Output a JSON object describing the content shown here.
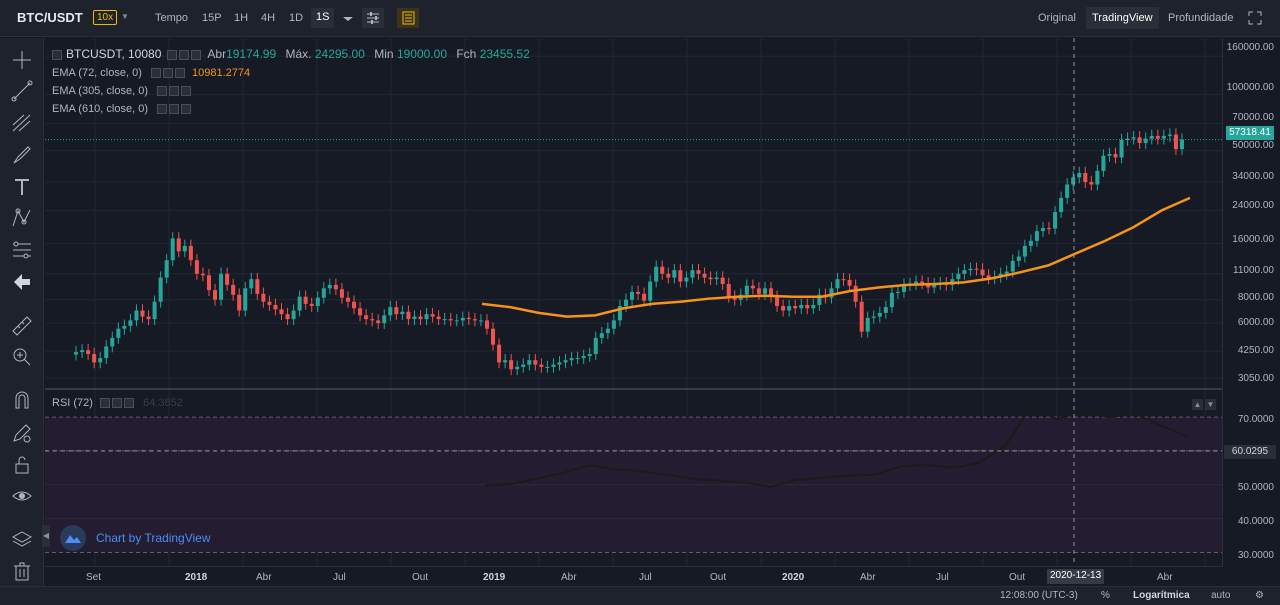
{
  "header": {
    "symbol": "BTC/USDT",
    "leverage": "10x",
    "timeframes": [
      {
        "label": "Tempo",
        "active": false
      },
      {
        "label": "15P",
        "active": false
      },
      {
        "label": "1H",
        "active": false
      },
      {
        "label": "4H",
        "active": false
      },
      {
        "label": "1D",
        "active": false
      },
      {
        "label": "1S",
        "active": true
      }
    ],
    "views": [
      {
        "label": "Original",
        "active": false
      },
      {
        "label": "TradingView",
        "active": true
      },
      {
        "label": "Profundidade",
        "active": false
      }
    ]
  },
  "legend": {
    "symbol": "BTCUSDT, 10080",
    "open_label": "Abr",
    "open": "19174.99",
    "high_label": "Máx.",
    "high": "24295.00",
    "low_label": "Min",
    "low": "19000.00",
    "close_label": "Fch",
    "close": "23455.52"
  },
  "indicators": [
    {
      "label": "EMA (72, close, 0)",
      "value": "10981.2774"
    },
    {
      "label": "EMA (305, close, 0)",
      "value": ""
    },
    {
      "label": "EMA (610, close, 0)",
      "value": ""
    }
  ],
  "rsi": {
    "label": "RSI (72)",
    "value": "64.3852",
    "levels": [
      "70.0000",
      "60.0295",
      "50.0000",
      "40.0000",
      "30.0000"
    ]
  },
  "price_axis": [
    "160000.00",
    "100000.00",
    "70000.00",
    "50000.00",
    "34000.00",
    "24000.00",
    "16000.00",
    "11000.00",
    "8000.00",
    "6000.00",
    "4250.00",
    "3050.00"
  ],
  "last_price": "57318.41",
  "time_axis": [
    {
      "label": "Set",
      "bold": false
    },
    {
      "label": "2018",
      "bold": true
    },
    {
      "label": "Abr",
      "bold": false
    },
    {
      "label": "Jul",
      "bold": false
    },
    {
      "label": "Out",
      "bold": false
    },
    {
      "label": "2019",
      "bold": true
    },
    {
      "label": "Abr",
      "bold": false
    },
    {
      "label": "Jul",
      "bold": false
    },
    {
      "label": "Out",
      "bold": false
    },
    {
      "label": "2020",
      "bold": true
    },
    {
      "label": "Abr",
      "bold": false
    },
    {
      "label": "Jul",
      "bold": false
    },
    {
      "label": "Out",
      "bold": false
    },
    {
      "label": "Abr",
      "bold": false
    }
  ],
  "crosshair_date": "2020-12-13",
  "watermark": "Chart by TradingView",
  "footer": {
    "time": "12:08:00 (UTC-3)",
    "percent": "%",
    "log": "Logarítmica",
    "auto": "auto"
  },
  "colors": {
    "up": "#26a69a",
    "down": "#ef5350",
    "ema": "#f7931a",
    "rsi": "#1a1a1a",
    "rsi_bg": "#241c30"
  },
  "chart_data": {
    "type": "candlestick",
    "price_scale": "log",
    "ylim": [
      2700,
      200000
    ],
    "candles_close_approx": [
      4200,
      4300,
      4100,
      3700,
      3900,
      4500,
      5000,
      5600,
      5800,
      6200,
      7000,
      6500,
      6300,
      7800,
      10500,
      13000,
      17000,
      14500,
      15500,
      13000,
      11000,
      10800,
      9000,
      8000,
      11000,
      9600,
      8500,
      7000,
      9200,
      10300,
      8600,
      7800,
      7500,
      7100,
      6700,
      6300,
      7000,
      8300,
      7600,
      7400,
      8200,
      9200,
      9600,
      9100,
      8200,
      7800,
      7200,
      6600,
      6300,
      6200,
      6000,
      6600,
      7300,
      6700,
      6900,
      6300,
      6500,
      6300,
      6700,
      6500,
      6300,
      6300,
      6200,
      6200,
      6400,
      6300,
      6200,
      6200,
      5600,
      4600,
      3700,
      3800,
      3400,
      3500,
      3600,
      3800,
      3600,
      3500,
      3500,
      3600,
      3700,
      3800,
      3900,
      3900,
      4000,
      4100,
      5000,
      5300,
      5600,
      6200,
      7400,
      8000,
      8800,
      8600,
      7900,
      10000,
      12000,
      11000,
      10500,
      11500,
      10000,
      10500,
      11500,
      11000,
      10500,
      10300,
      10500,
      9700,
      8300,
      8000,
      8500,
      9500,
      9200,
      8600,
      9200,
      8300,
      7400,
      7000,
      7400,
      7200,
      7500,
      7200,
      7500,
      8500,
      8200,
      9200,
      10300,
      10200,
      9500,
      7800,
      5400,
      6400,
      6500,
      6800,
      7300,
      8700,
      8800,
      9600,
      9700,
      10000,
      9800,
      9300,
      9700,
      9800,
      9600,
      10300,
      11000,
      11500,
      11700,
      11600,
      10800,
      10400,
      10600,
      11000,
      11300,
      12900,
      13600,
      15500,
      16500,
      18600,
      19300,
      19200,
      23500,
      28000,
      33000,
      36000,
      38000,
      34000,
      33000,
      39000,
      47000,
      48000,
      46000,
      57000,
      58000,
      59000,
      55000,
      58000,
      60000,
      58000,
      60000,
      61000,
      51000,
      57318
    ],
    "ema72_approx": [
      7600,
      7300,
      6800,
      6500,
      6600,
      7200,
      7600,
      7800,
      8100,
      8300,
      8400,
      8300,
      8300,
      8900,
      9300,
      9600,
      9700,
      9900,
      10400,
      11200,
      12200,
      14200,
      16500,
      19500,
      24000,
      28000
    ],
    "rsi_approx": [
      49.8,
      50.2,
      51.8,
      53.5,
      55.8,
      54.6,
      54.0,
      53.0,
      51.8,
      51.2,
      50.6,
      49.4,
      51.4,
      52.2,
      52.7,
      53.0,
      55.5,
      55.8,
      55.0,
      56.5,
      61.5,
      73.0,
      69.4,
      71.6,
      70.0,
      71.0,
      67.5,
      64.4
    ]
  }
}
